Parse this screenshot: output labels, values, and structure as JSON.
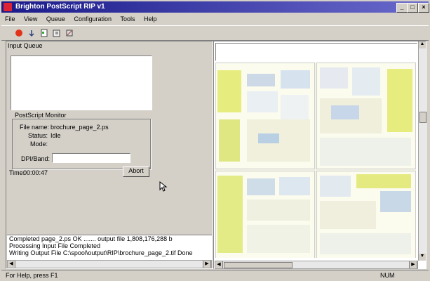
{
  "window": {
    "title": "Brighton PostScript RIP v1"
  },
  "menu": [
    "File",
    "View",
    "Queue",
    "Configuration",
    "Tools",
    "Help"
  ],
  "input_queue": {
    "label": "Input Queue"
  },
  "monitor": {
    "label": "PostScript Monitor",
    "file_label": "File name:",
    "file_value": "brochure_page_2.ps",
    "status_label": "Status:",
    "status_value": "Idle",
    "mode_label": "Mode:",
    "dpi_label": "DPI/Band:",
    "dpi_value": "",
    "time_label": "Time:",
    "time_value": "00:00:47",
    "abort_label": "Abort"
  },
  "log": [
    "Completed page_2.ps OK ....... output file 1,808,176,288 b",
    "Processing Input File Completed",
    "Writing Output File C:\\spool\\output\\RIP\\brochure_page_2.tif Done"
  ],
  "status": {
    "left": "For Help, press F1",
    "right": "NUM"
  }
}
